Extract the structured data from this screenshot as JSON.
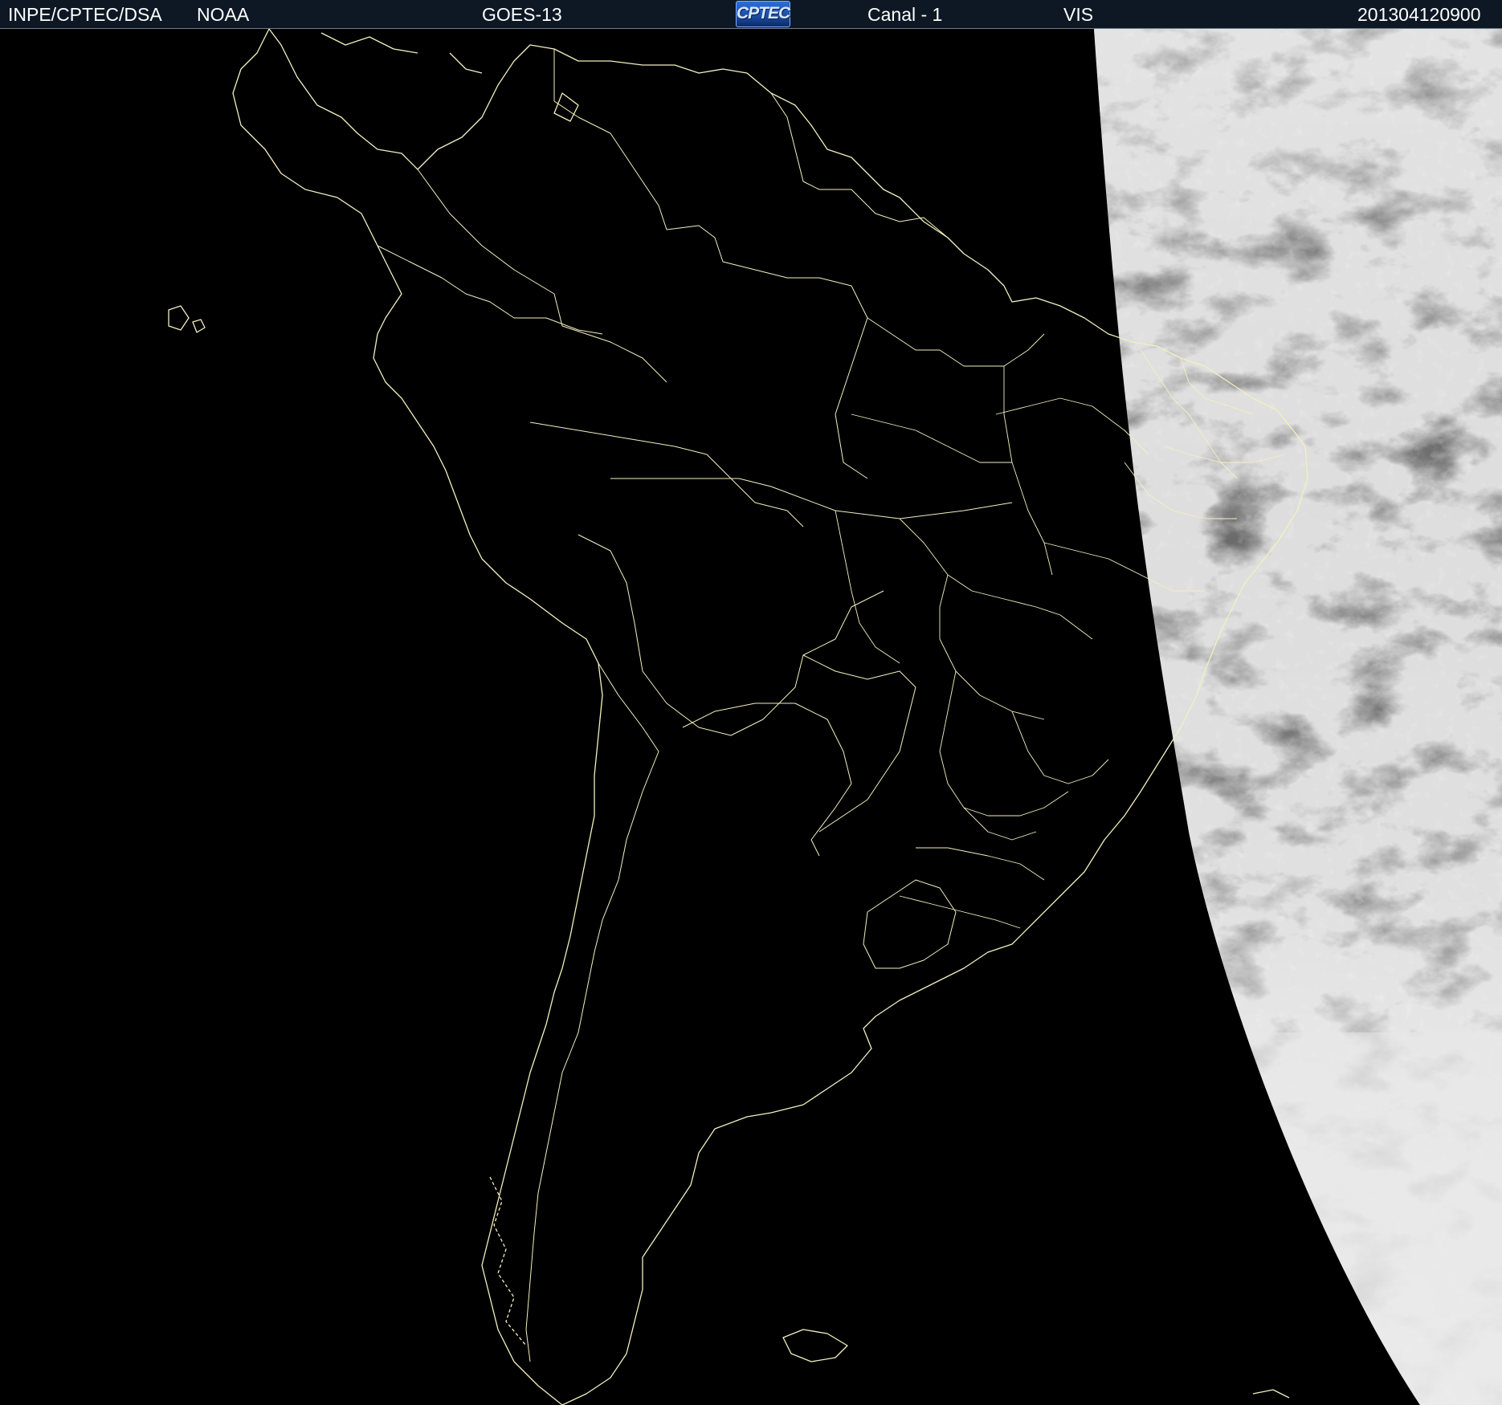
{
  "header": {
    "agency": "INPE/CPTEC/DSA",
    "source": "NOAA",
    "satellite": "GOES-13",
    "logo_text": "CPTEC",
    "channel": "Canal - 1",
    "band": "VIS",
    "timestamp": "201304120900"
  },
  "colors": {
    "header_bg": "#0d1824",
    "header_text": "#ffffff",
    "space": "#000000",
    "coastline": "#f4f0c0",
    "cloud_light": "#e6e6e6",
    "cloud_dark": "#5a5a5a",
    "logo_blue": "#2b6fd6"
  },
  "map": {
    "type": "satellite-visible-image",
    "region": "South America",
    "overlay_icons": [
      "coastline-outline",
      "country-borders",
      "state-borders"
    ]
  }
}
